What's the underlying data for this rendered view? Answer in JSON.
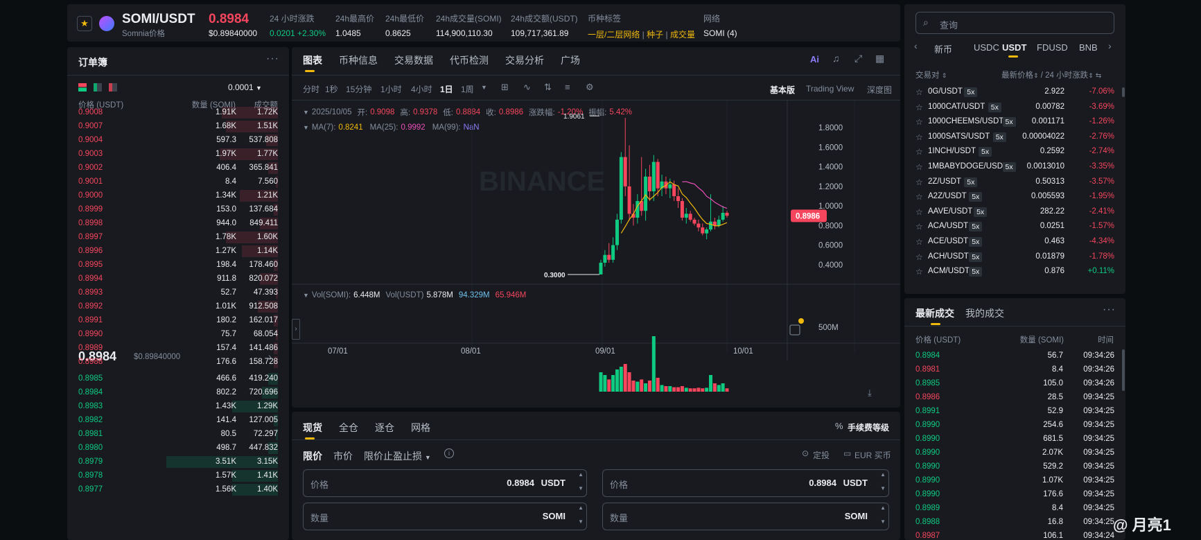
{
  "header": {
    "symbol": "SOMI/USDT",
    "subtitle": "Somnia价格",
    "price": "0.8984",
    "price_usd": "$0.89840000",
    "stats": [
      {
        "label": "24 小时涨跌",
        "value": "0.0201 +2.30%",
        "color": "green"
      },
      {
        "label": "24h最高价",
        "value": "1.0485",
        "color": "white"
      },
      {
        "label": "24h最低价",
        "value": "0.8625",
        "color": "white"
      },
      {
        "label": "24h成交量(SOMI)",
        "value": "114,900,110.30",
        "color": "white"
      },
      {
        "label": "24h成交额(USDT)",
        "value": "109,717,361.89",
        "color": "white"
      }
    ],
    "tags_label": "币种标签",
    "tags": [
      "一层/二层网络",
      "种子",
      "成交量"
    ],
    "network_label": "网络",
    "network_value": "SOMI (4)"
  },
  "orderbook": {
    "title": "订单簿",
    "precision": "0.0001",
    "col_price": "价格 (USDT)",
    "col_amount": "数量 (SOMI)",
    "col_total": "成交额",
    "asks": [
      {
        "price": "0.9008",
        "amount": "1.91K",
        "total": "1.72K",
        "depth": 0.28
      },
      {
        "price": "0.9007",
        "amount": "1.68K",
        "total": "1.51K",
        "depth": 0.26
      },
      {
        "price": "0.9004",
        "amount": "597.3",
        "total": "537.808",
        "depth": 0.06
      },
      {
        "price": "0.9003",
        "amount": "1.97K",
        "total": "1.77K",
        "depth": 0.29
      },
      {
        "price": "0.9002",
        "amount": "406.4",
        "total": "365.841",
        "depth": 0.05
      },
      {
        "price": "0.9001",
        "amount": "8.4",
        "total": "7.560",
        "depth": 0.01
      },
      {
        "price": "0.9000",
        "amount": "1.34K",
        "total": "1.21K",
        "depth": 0.19
      },
      {
        "price": "0.8999",
        "amount": "153.0",
        "total": "137.684",
        "depth": 0.02
      },
      {
        "price": "0.8998",
        "amount": "944.0",
        "total": "849.411",
        "depth": 0.09
      },
      {
        "price": "0.8997",
        "amount": "1.78K",
        "total": "1.60K",
        "depth": 0.26
      },
      {
        "price": "0.8996",
        "amount": "1.27K",
        "total": "1.14K",
        "depth": 0.18
      },
      {
        "price": "0.8995",
        "amount": "198.4",
        "total": "178.460",
        "depth": 0.02
      },
      {
        "price": "0.8994",
        "amount": "911.8",
        "total": "820.072",
        "depth": 0.09
      },
      {
        "price": "0.8993",
        "amount": "52.7",
        "total": "47.393",
        "depth": 0.01
      },
      {
        "price": "0.8992",
        "amount": "1.01K",
        "total": "912.508",
        "depth": 0.1
      },
      {
        "price": "0.8991",
        "amount": "180.2",
        "total": "162.017",
        "depth": 0.02
      },
      {
        "price": "0.8990",
        "amount": "75.7",
        "total": "68.054",
        "depth": 0.01
      },
      {
        "price": "0.8989",
        "amount": "157.4",
        "total": "141.486",
        "depth": 0.02
      },
      {
        "price": "0.8988",
        "amount": "176.6",
        "total": "158.728",
        "depth": 0.02
      }
    ],
    "last_price": "0.8984",
    "last_price_usd": "$0.89840000",
    "bids": [
      {
        "price": "0.8985",
        "amount": "466.6",
        "total": "419.240",
        "depth": 0.05
      },
      {
        "price": "0.8984",
        "amount": "802.2",
        "total": "720.696",
        "depth": 0.08
      },
      {
        "price": "0.8983",
        "amount": "1.43K",
        "total": "1.29K",
        "depth": 0.23
      },
      {
        "price": "0.8982",
        "amount": "141.4",
        "total": "127.005",
        "depth": 0.02
      },
      {
        "price": "0.8981",
        "amount": "80.5",
        "total": "72.297",
        "depth": 0.01
      },
      {
        "price": "0.8980",
        "amount": "498.7",
        "total": "447.832",
        "depth": 0.05
      },
      {
        "price": "0.8979",
        "amount": "3.51K",
        "total": "3.15K",
        "depth": 0.56
      },
      {
        "price": "0.8978",
        "amount": "1.57K",
        "total": "1.41K",
        "depth": 0.23
      },
      {
        "price": "0.8977",
        "amount": "1.56K",
        "total": "1.40K",
        "depth": 0.23
      }
    ]
  },
  "chart_tabs": [
    "图表",
    "币种信息",
    "交易数据",
    "代币检测",
    "交易分析",
    "广场"
  ],
  "intervals": [
    "分时",
    "1秒",
    "15分钟",
    "1小时",
    "4小时",
    "1日",
    "1周"
  ],
  "active_interval": "1日",
  "view_modes": [
    "基本版",
    "Trading View",
    "深度图"
  ],
  "ohlc": {
    "date": "2025/10/05",
    "open_label": "开:",
    "open": "0.9098",
    "high_label": "高:",
    "high": "0.9378",
    "low_label": "低:",
    "low": "0.8884",
    "close_label": "收:",
    "close": "0.8986",
    "change_label": "涨跌幅:",
    "change": "-1.20%",
    "amp_label": "振幅:",
    "amp": "5.42%"
  },
  "ma": {
    "ma7_label": "MA(7):",
    "ma7": "0.8241",
    "ma25_label": "MA(25):",
    "ma25": "0.9992",
    "ma99_label": "MA(99):",
    "ma99": "NaN"
  },
  "vol": {
    "somi_label": "Vol(SOMI):",
    "somi": "6.448M",
    "usdt_label": "Vol(USDT)",
    "usdt": "5.878M",
    "v1": "94.329M",
    "v2": "65.946M"
  },
  "watermark": "BINANCE",
  "chart_data": {
    "type": "candlestick",
    "y_ticks": [
      "1.8000",
      "1.6000",
      "1.4000",
      "1.2000",
      "1.0000",
      "0.8000",
      "0.6000",
      "0.4000"
    ],
    "ylim": [
      0.25,
      1.95
    ],
    "x_ticks": [
      "07/01",
      "08/01",
      "09/01",
      "10/01"
    ],
    "vol_tick": "500M",
    "high_marker": "1.9061",
    "low_marker": "0.3000",
    "current_price": "0.8986",
    "candles": [
      {
        "o": 0.3,
        "h": 0.45,
        "l": 0.3,
        "c": 0.42,
        "v": 0.35
      },
      {
        "o": 0.42,
        "h": 0.55,
        "l": 0.38,
        "c": 0.5,
        "v": 0.3
      },
      {
        "o": 0.5,
        "h": 0.62,
        "l": 0.42,
        "c": 0.45,
        "v": 0.22
      },
      {
        "o": 0.45,
        "h": 0.68,
        "l": 0.42,
        "c": 0.6,
        "v": 0.3
      },
      {
        "o": 0.6,
        "h": 0.92,
        "l": 0.55,
        "c": 0.86,
        "v": 0.4
      },
      {
        "o": 0.86,
        "h": 1.55,
        "l": 0.82,
        "c": 1.5,
        "v": 0.45
      },
      {
        "o": 1.5,
        "h": 1.9,
        "l": 1.1,
        "c": 1.2,
        "v": 0.5
      },
      {
        "o": 1.2,
        "h": 1.62,
        "l": 0.85,
        "c": 0.92,
        "v": 0.35
      },
      {
        "o": 0.92,
        "h": 1.02,
        "l": 0.8,
        "c": 0.88,
        "v": 0.2
      },
      {
        "o": 0.88,
        "h": 1.12,
        "l": 0.82,
        "c": 1.05,
        "v": 0.18
      },
      {
        "o": 1.05,
        "h": 1.5,
        "l": 0.9,
        "c": 0.95,
        "v": 0.22
      },
      {
        "o": 0.95,
        "h": 1.38,
        "l": 0.85,
        "c": 1.3,
        "v": 0.15
      },
      {
        "o": 1.3,
        "h": 1.42,
        "l": 1.05,
        "c": 1.15,
        "v": 0.2
      },
      {
        "o": 1.15,
        "h": 1.52,
        "l": 1.05,
        "c": 1.45,
        "v": 1.0
      },
      {
        "o": 1.45,
        "h": 1.48,
        "l": 1.1,
        "c": 1.18,
        "v": 0.25
      },
      {
        "o": 1.18,
        "h": 1.32,
        "l": 1.1,
        "c": 1.25,
        "v": 0.12
      },
      {
        "o": 1.25,
        "h": 1.3,
        "l": 1.12,
        "c": 1.18,
        "v": 0.1
      },
      {
        "o": 1.18,
        "h": 1.28,
        "l": 1.08,
        "c": 1.22,
        "v": 0.1
      },
      {
        "o": 1.22,
        "h": 1.26,
        "l": 1.05,
        "c": 1.1,
        "v": 0.08
      },
      {
        "o": 1.1,
        "h": 1.18,
        "l": 0.98,
        "c": 1.05,
        "v": 0.08
      },
      {
        "o": 1.05,
        "h": 1.08,
        "l": 0.85,
        "c": 0.88,
        "v": 0.1
      },
      {
        "o": 0.88,
        "h": 0.98,
        "l": 0.82,
        "c": 0.92,
        "v": 0.07
      },
      {
        "o": 0.92,
        "h": 0.95,
        "l": 0.84,
        "c": 0.86,
        "v": 0.06
      },
      {
        "o": 0.86,
        "h": 0.88,
        "l": 0.8,
        "c": 0.82,
        "v": 0.06
      },
      {
        "o": 0.82,
        "h": 0.86,
        "l": 0.74,
        "c": 0.78,
        "v": 0.07
      },
      {
        "o": 0.78,
        "h": 0.82,
        "l": 0.7,
        "c": 0.72,
        "v": 0.06
      },
      {
        "o": 0.72,
        "h": 0.78,
        "l": 0.66,
        "c": 0.76,
        "v": 0.07
      },
      {
        "o": 0.76,
        "h": 1.12,
        "l": 0.74,
        "c": 0.84,
        "v": 0.3
      },
      {
        "o": 0.84,
        "h": 0.88,
        "l": 0.76,
        "c": 0.8,
        "v": 0.15
      },
      {
        "o": 0.8,
        "h": 0.9,
        "l": 0.78,
        "c": 0.86,
        "v": 0.12
      },
      {
        "o": 0.86,
        "h": 1.0,
        "l": 0.84,
        "c": 0.93,
        "v": 0.15
      },
      {
        "o": 0.93,
        "h": 0.95,
        "l": 0.88,
        "c": 0.9,
        "v": 0.06
      }
    ]
  },
  "trade": {
    "tabs": [
      "现货",
      "全仓",
      "逐仓",
      "网格"
    ],
    "fee_label": "手续费等级",
    "order_types": [
      "限价",
      "市价",
      "限价止盈止损"
    ],
    "dca_label": "定投",
    "buy_eur_label": "EUR 买币",
    "buy_price_label": "价格",
    "buy_price": "0.8984",
    "buy_price_unit": "USDT",
    "buy_qty_label": "数量",
    "buy_qty_unit": "SOMI",
    "sell_price_label": "价格",
    "sell_price": "0.8984",
    "sell_price_unit": "USDT",
    "sell_qty_label": "数量",
    "sell_qty_unit": "SOMI"
  },
  "market": {
    "search_placeholder": "查询",
    "tabs": [
      "新币",
      "USDC",
      "USDT",
      "FDUSD",
      "BNB"
    ],
    "active_tab": "USDT",
    "col_pair": "交易对",
    "col_price": "最新价格",
    "col_sep": "/",
    "col_change": "24 小时涨跌",
    "rows": [
      {
        "pair": "0G/USDT",
        "lev": "5x",
        "price": "2.922",
        "change": "-7.06%"
      },
      {
        "pair": "1000CAT/USDT",
        "lev": "5x",
        "price": "0.00782",
        "change": "-3.69%"
      },
      {
        "pair": "1000CHEEMS/USDT",
        "lev": "5x",
        "price": "0.001171",
        "change": "-1.26%"
      },
      {
        "pair": "1000SATS/USDT",
        "lev": "5x",
        "price": "0.00004022",
        "change": "-2.76%"
      },
      {
        "pair": "1INCH/USDT",
        "lev": "5x",
        "price": "0.2592",
        "change": "-2.74%"
      },
      {
        "pair": "1MBABYDOGE/USDT",
        "lev": "5x",
        "price": "0.0013010",
        "change": "-3.35%"
      },
      {
        "pair": "2Z/USDT",
        "lev": "5x",
        "price": "0.50313",
        "change": "-3.57%"
      },
      {
        "pair": "A2Z/USDT",
        "lev": "5x",
        "price": "0.005593",
        "change": "-1.95%"
      },
      {
        "pair": "AAVE/USDT",
        "lev": "5x",
        "price": "282.22",
        "change": "-2.41%"
      },
      {
        "pair": "ACA/USDT",
        "lev": "5x",
        "price": "0.0251",
        "change": "-1.57%"
      },
      {
        "pair": "ACE/USDT",
        "lev": "5x",
        "price": "0.463",
        "change": "-4.34%"
      },
      {
        "pair": "ACH/USDT",
        "lev": "5x",
        "price": "0.01879",
        "change": "-1.78%"
      },
      {
        "pair": "ACM/USDT",
        "lev": "5x",
        "price": "0.876",
        "change": "+0.11%"
      }
    ]
  },
  "trades": {
    "tab_latest": "最新成交",
    "tab_mine": "我的成交",
    "col_price": "价格 (USDT)",
    "col_amount": "数量 (SOMI)",
    "col_time": "时间",
    "rows": [
      {
        "price": "0.8984",
        "amount": "56.7",
        "time": "09:34:26",
        "side": "buy"
      },
      {
        "price": "0.8981",
        "amount": "8.4",
        "time": "09:34:26",
        "side": "sell"
      },
      {
        "price": "0.8985",
        "amount": "105.0",
        "time": "09:34:26",
        "side": "buy"
      },
      {
        "price": "0.8986",
        "amount": "28.5",
        "time": "09:34:25",
        "side": "sell"
      },
      {
        "price": "0.8991",
        "amount": "52.9",
        "time": "09:34:25",
        "side": "buy"
      },
      {
        "price": "0.8990",
        "amount": "254.6",
        "time": "09:34:25",
        "side": "buy"
      },
      {
        "price": "0.8990",
        "amount": "681.5",
        "time": "09:34:25",
        "side": "buy"
      },
      {
        "price": "0.8990",
        "amount": "2.07K",
        "time": "09:34:25",
        "side": "buy"
      },
      {
        "price": "0.8990",
        "amount": "529.2",
        "time": "09:34:25",
        "side": "buy"
      },
      {
        "price": "0.8990",
        "amount": "1.07K",
        "time": "09:34:25",
        "side": "buy"
      },
      {
        "price": "0.8990",
        "amount": "176.6",
        "time": "09:34:25",
        "side": "buy"
      },
      {
        "price": "0.8989",
        "amount": "8.4",
        "time": "09:34:25",
        "side": "buy"
      },
      {
        "price": "0.8988",
        "amount": "16.8",
        "time": "09:34:25",
        "side": "buy"
      },
      {
        "price": "0.8987",
        "amount": "106.1",
        "time": "09:34:24",
        "side": "sell"
      }
    ]
  },
  "watermark_user": "@ 月亮1",
  "colors": {
    "red": "#f6465d",
    "green": "#0ecb81",
    "yellow": "#f0b90b",
    "panel": "#181a20",
    "bg": "#0b0e11"
  }
}
